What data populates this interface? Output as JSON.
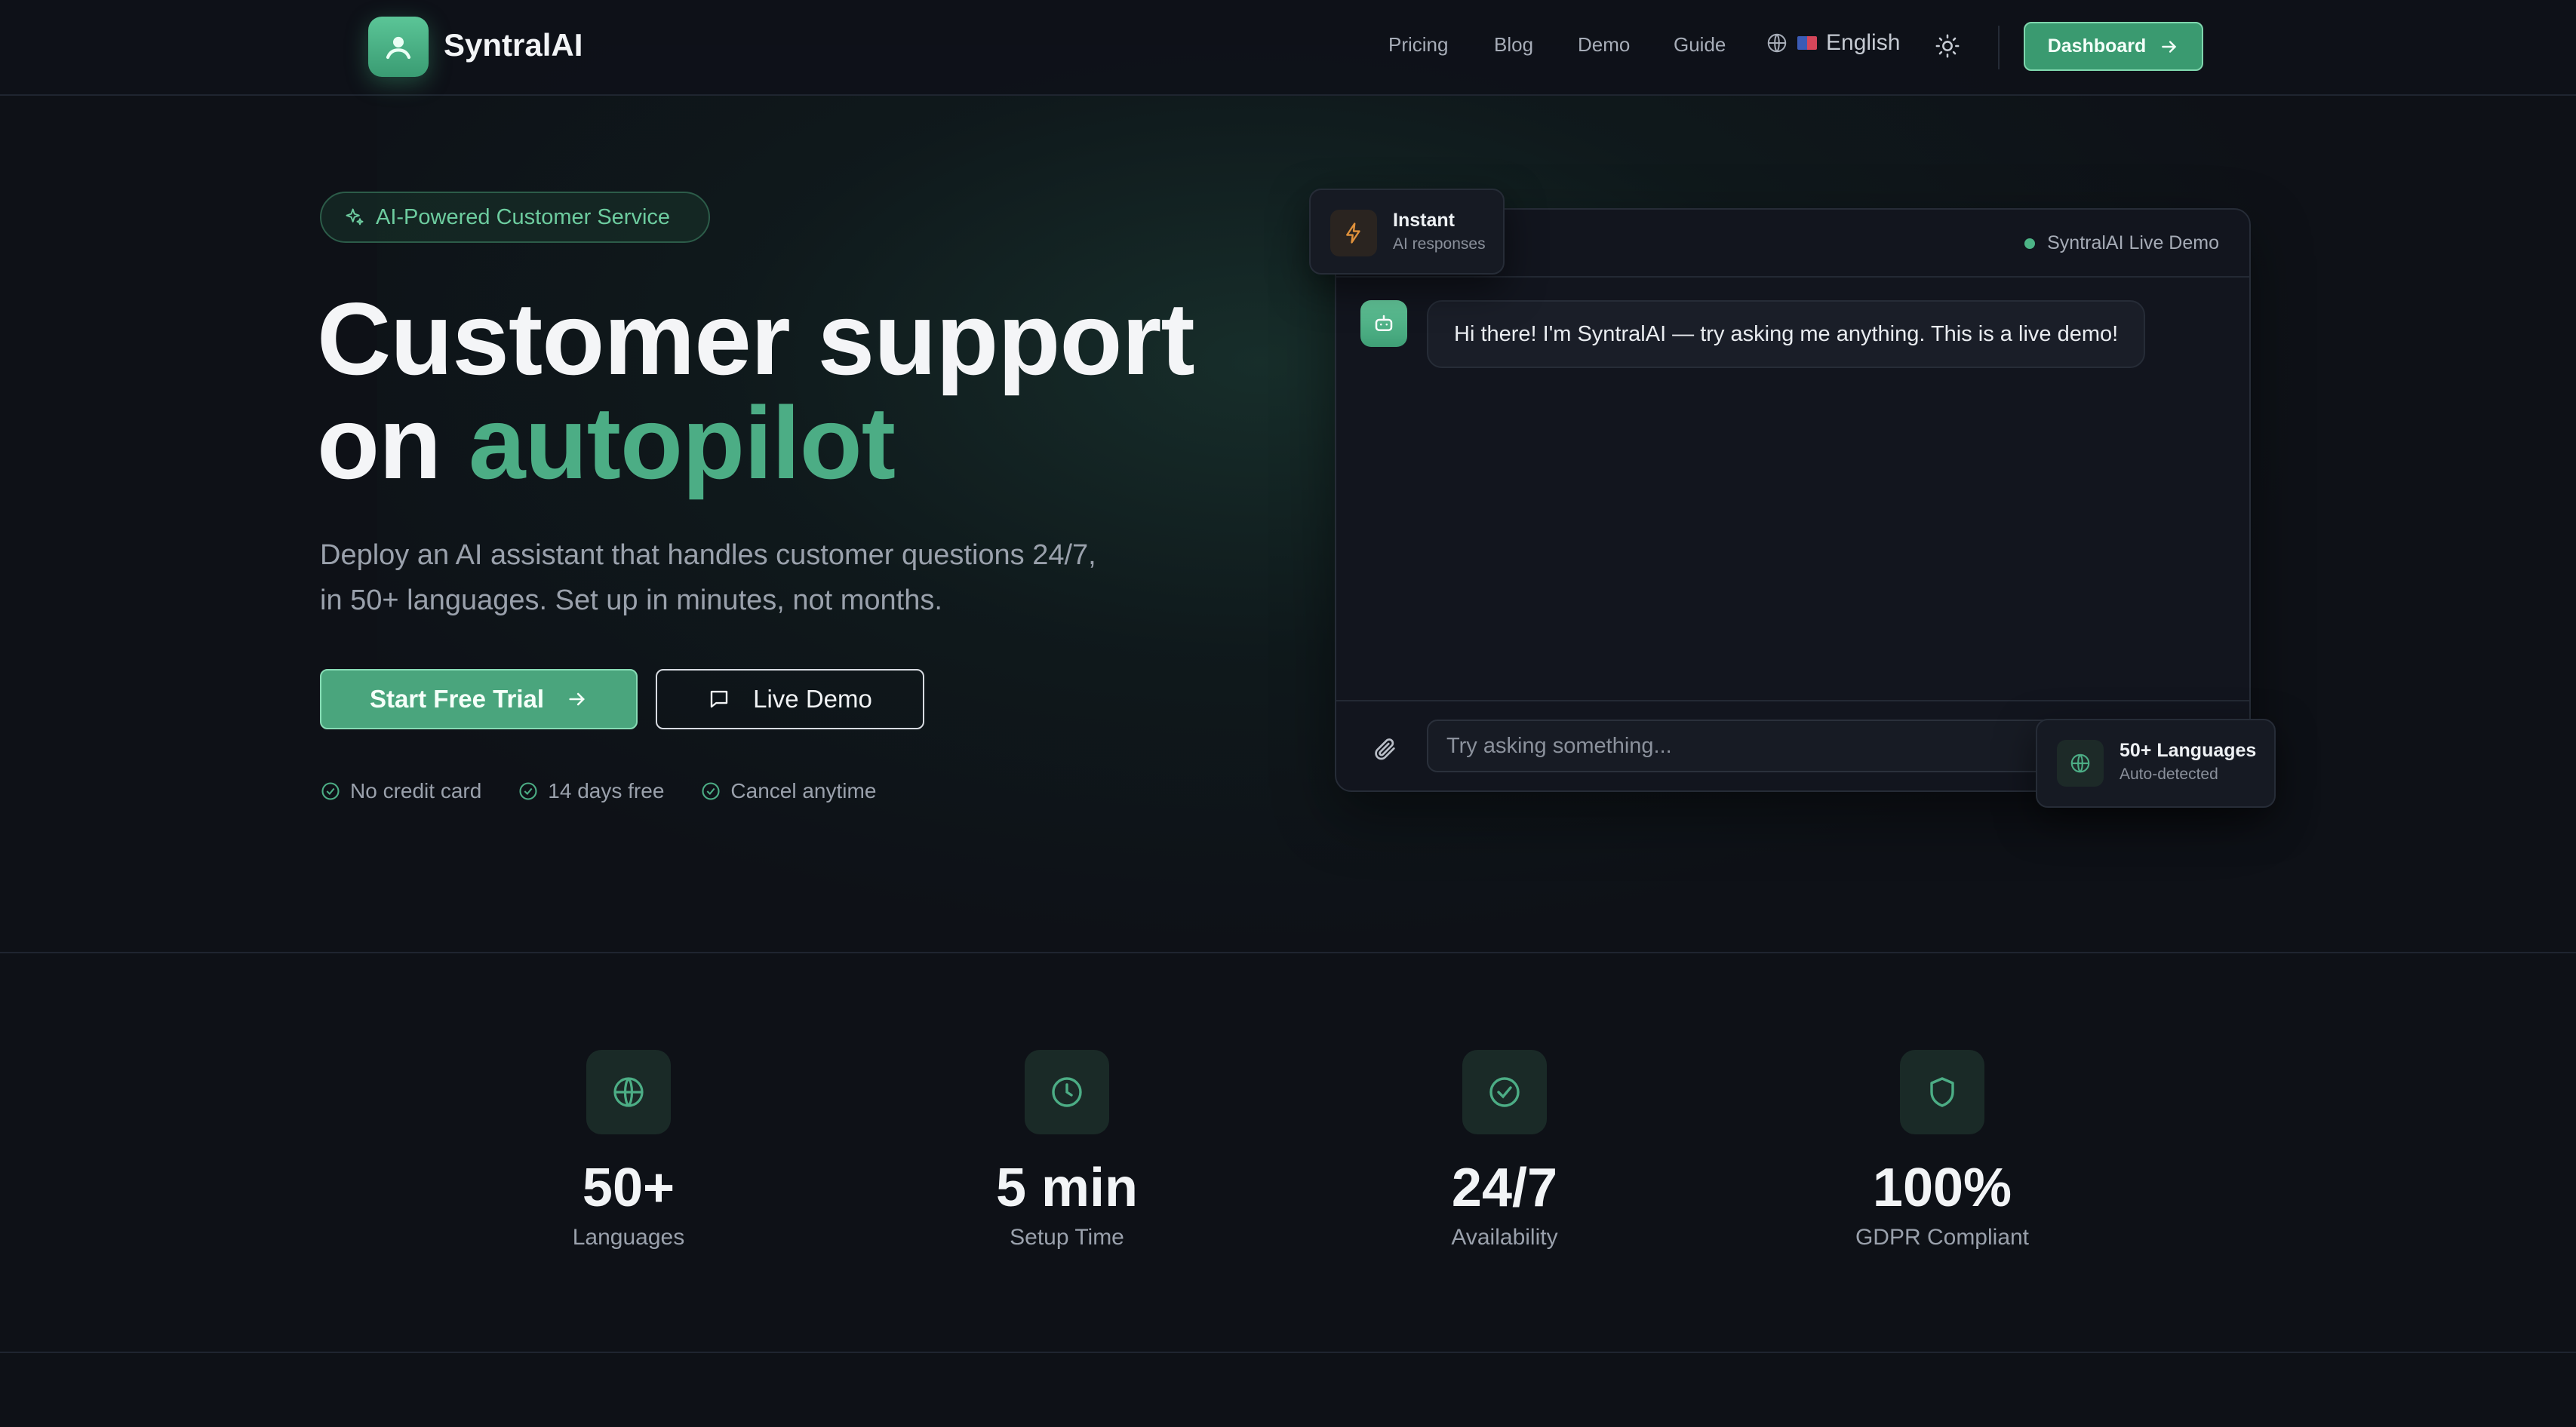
{
  "brand": {
    "name": "SyntralAI"
  },
  "nav": {
    "links": [
      "Pricing",
      "Blog",
      "Demo",
      "Guide"
    ],
    "language": "English",
    "dashboard_label": "Dashboard"
  },
  "hero": {
    "badge": "AI-Powered Customer Service",
    "title_line1": "Customer support",
    "title_line2_prefix": "on ",
    "title_line2_accent": "autopilot",
    "subtitle_line1": "Deploy an AI assistant that handles customer questions 24/7,",
    "subtitle_line2": "in 50+ languages. Set up in minutes, not months.",
    "primary_cta": "Start Free Trial",
    "secondary_cta": "Live Demo",
    "perks": [
      "No credit card",
      "14 days free",
      "Cancel anytime"
    ]
  },
  "demo": {
    "live_label": "SyntralAI Live Demo",
    "bot_message": "Hi there! I'm SyntralAI — try asking me anything. This is a live demo!",
    "input_placeholder": "Try asking something...",
    "instant_title": "Instant",
    "instant_sub": "AI responses",
    "lang_title": "50+ Languages",
    "lang_sub": "Auto-detected"
  },
  "stats": [
    {
      "value": "50+",
      "label": "Languages",
      "icon": "globe-icon"
    },
    {
      "value": "5 min",
      "label": "Setup Time",
      "icon": "clock-icon"
    },
    {
      "value": "24/7",
      "label": "Availability",
      "icon": "check-circle-icon"
    },
    {
      "value": "100%",
      "label": "GDPR Compliant",
      "icon": "shield-icon"
    }
  ],
  "colors": {
    "accent": "#4cad85",
    "background": "#0e1117",
    "warning": "#e0913b"
  }
}
